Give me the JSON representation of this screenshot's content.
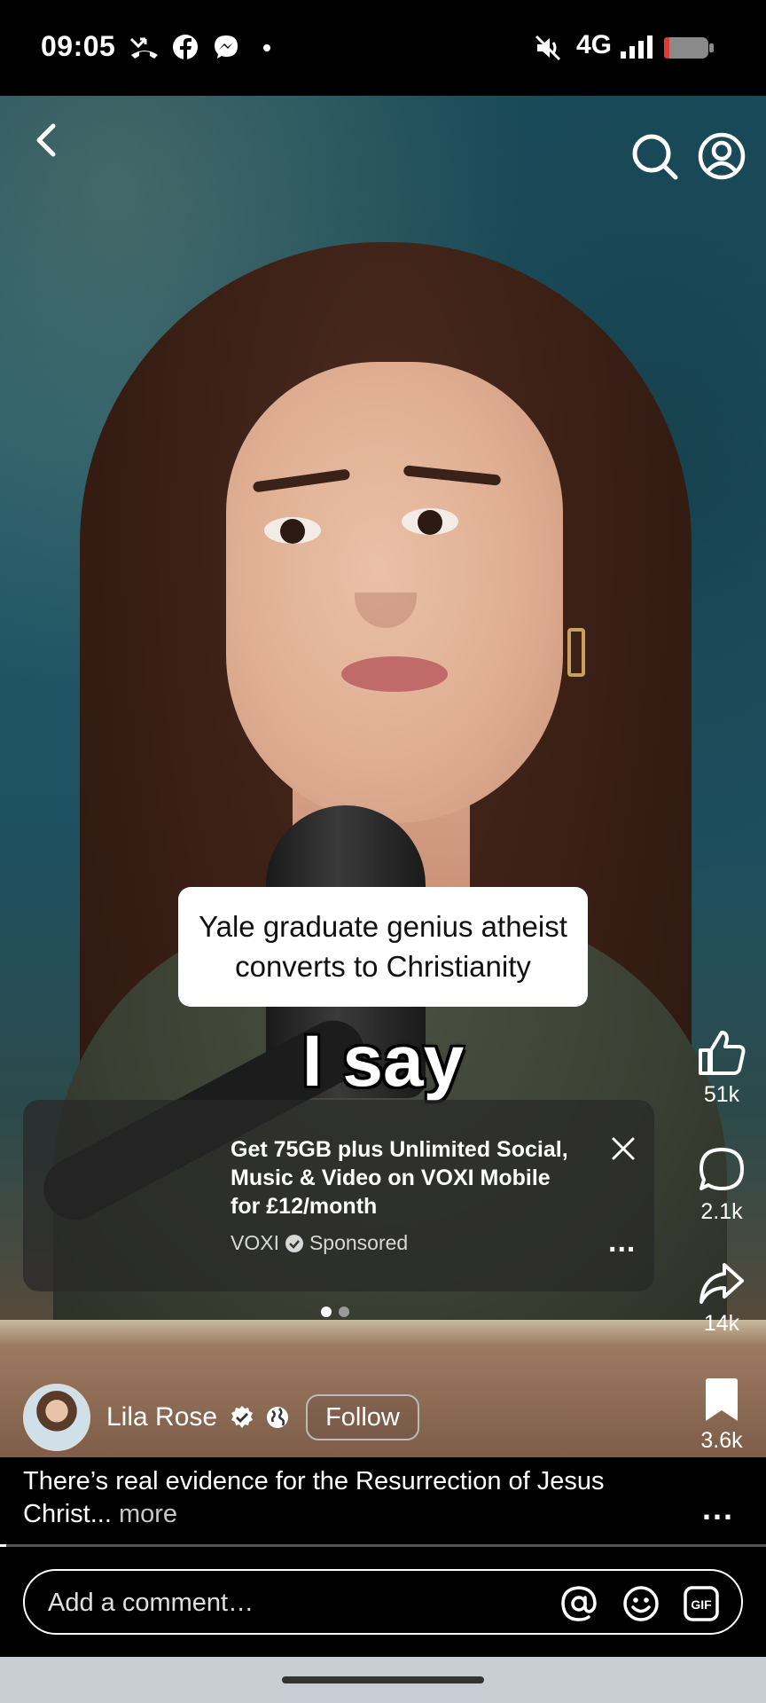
{
  "status_bar": {
    "time": "09:05",
    "network": "4G",
    "icons": [
      "missed-call-icon",
      "facebook-icon",
      "messenger-icon",
      "dot-icon",
      "mute-icon",
      "signal-icon",
      "battery-icon"
    ]
  },
  "top_bar": {
    "icons": [
      "back-icon",
      "search-icon",
      "profile-icon"
    ]
  },
  "video": {
    "caption": "Yale graduate genius atheist converts to Christianity",
    "subtitle": "I say"
  },
  "ad": {
    "title": "Get 75GB plus Unlimited Social, Music & Video on VOXI Mobile for £12/month",
    "advertiser": "VOXI",
    "sponsored_label": "Sponsored",
    "more_label": "...",
    "carousel": {
      "count": 2,
      "active_index": 0
    }
  },
  "actions": {
    "likes": "51k",
    "comments": "2.1k",
    "shares": "14k",
    "saves": "3.6k"
  },
  "author": {
    "name": "Lila Rose",
    "follow_label": "Follow"
  },
  "description": {
    "text": "There’s real evidence for the Resurrection of Jesus Christ...",
    "more_label": "more",
    "options_label": "..."
  },
  "playback": {
    "progress": 0.008
  },
  "comment_bar": {
    "placeholder": "Add a comment…",
    "icons": [
      "mention-icon",
      "emoji-icon",
      "gif-icon"
    ],
    "gif_label": "GIF"
  },
  "colors": {
    "background": "#000000",
    "text": "#ffffff",
    "caption_bg": "#ffffff",
    "nav_bar": "#c9cdd4"
  }
}
